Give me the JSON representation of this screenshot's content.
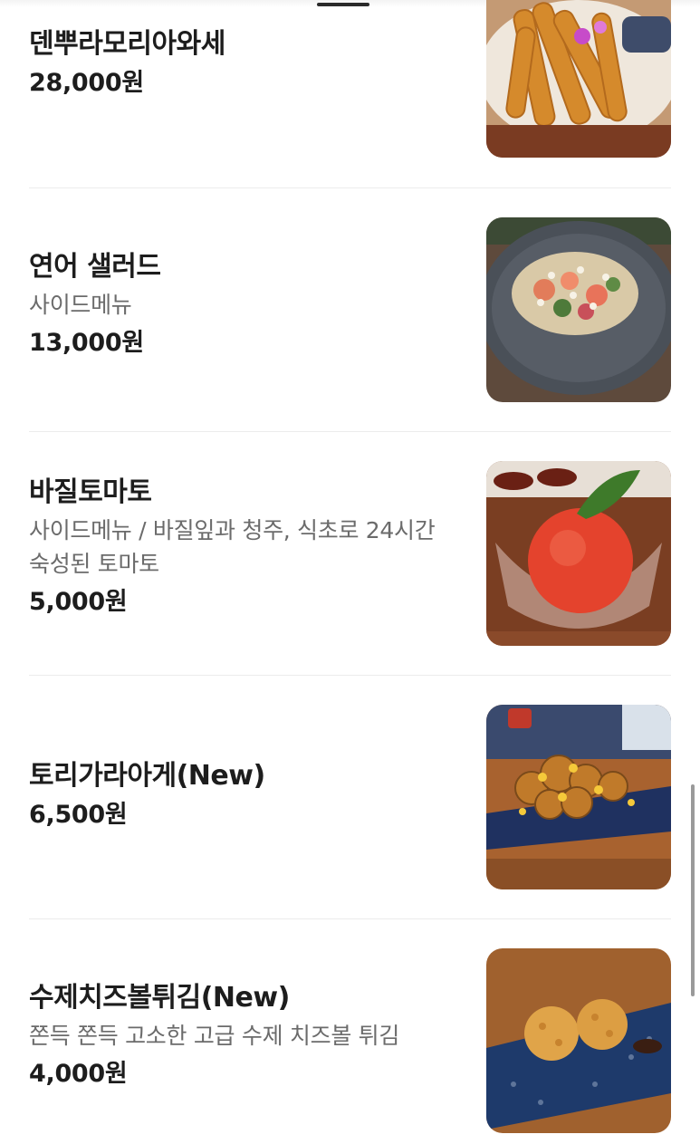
{
  "menu": {
    "items": [
      {
        "name": "덴뿌라모리아와세",
        "description": "",
        "price": "28,000원",
        "photo_icon": "tempura-photo"
      },
      {
        "name": "연어 샐러드",
        "description": "사이드메뉴",
        "price": "13,000원",
        "photo_icon": "salmon-salad-photo"
      },
      {
        "name": "바질토마토",
        "description": "사이드메뉴 / 바질잎과 청주, 식초로 24시간 숙성된 토마토",
        "price": "5,000원",
        "photo_icon": "basil-tomato-photo"
      },
      {
        "name": "토리가라아게(New)",
        "description": "",
        "price": "6,500원",
        "photo_icon": "karaage-photo"
      },
      {
        "name": "수제치즈볼튀김(New)",
        "description": "쫀득 쫀득 고소한 고급 수제 치즈볼 튀김",
        "price": "4,000원",
        "photo_icon": "cheese-ball-photo"
      }
    ]
  },
  "colors": {
    "text_primary": "#1d1d1d",
    "text_secondary": "#6b6b6b",
    "divider": "#ececec",
    "background": "#ffffff"
  }
}
